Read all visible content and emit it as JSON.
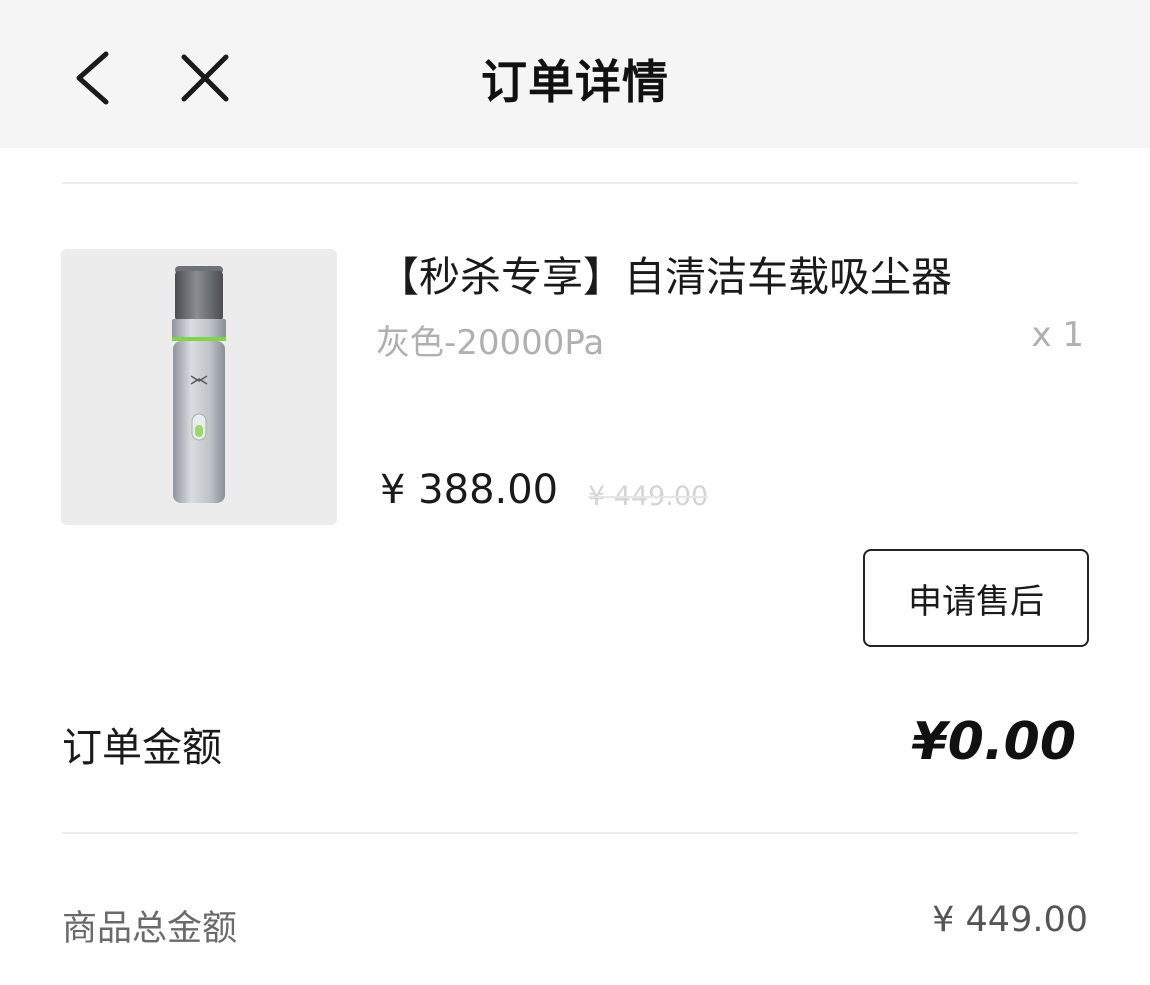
{
  "header": {
    "title": "订单详情",
    "back_icon": "chevron-left-icon",
    "close_icon": "close-icon"
  },
  "product": {
    "name": "【秒杀专享】自清洁车载吸尘器",
    "variant": "灰色-20000Pa",
    "quantity": "x 1",
    "price": "¥ 388.00",
    "original_price": "¥ 449.00",
    "image_icon": "handheld-vacuum-image"
  },
  "actions": {
    "after_sale_label": "申请售后"
  },
  "summary": {
    "order_amount_label": "订单金额",
    "order_amount_value": "¥0.00",
    "goods_total_label": "商品总金额",
    "goods_total_value": "¥ 449.00"
  }
}
